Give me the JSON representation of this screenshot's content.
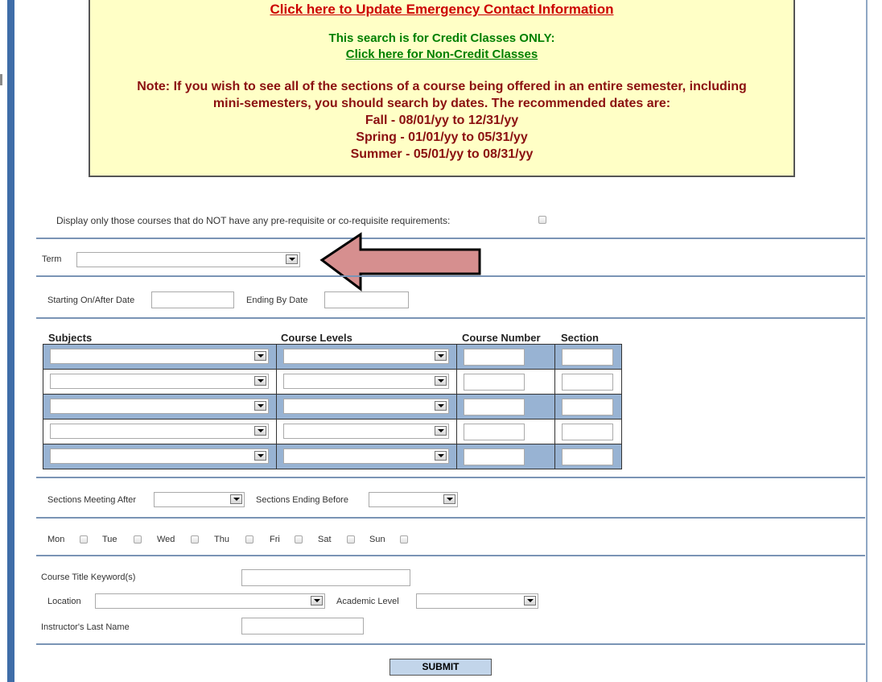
{
  "notice": {
    "emergency_link": "Click here to Update Emergency Contact Information",
    "credit_only": "This search is for Credit Classes ONLY:",
    "noncredit_link": "Click here for Non-Credit Classes",
    "note_line1": "Note: If you wish to see all of the sections of a course being offered in an entire semester, including",
    "note_line2": "mini-semesters, you should search by dates. The recommended dates are:",
    "fall": "Fall - 08/01/yy to 12/31/yy",
    "spring": "Spring - 01/01/yy to 05/31/yy",
    "summer": "Summer - 05/01/yy to 08/31/yy"
  },
  "prereq_label": "Display only those courses that do NOT have any pre-requisite or co-requisite requirements:",
  "term": {
    "label": "Term",
    "value": ""
  },
  "dates": {
    "start_label": "Starting On/After Date",
    "end_label": "Ending By Date",
    "start_value": "",
    "end_value": ""
  },
  "table": {
    "headers": {
      "subjects": "Subjects",
      "levels": "Course Levels",
      "number": "Course Number",
      "section": "Section"
    },
    "row_count": 5
  },
  "times": {
    "after_label": "Sections Meeting After",
    "before_label": "Sections Ending Before"
  },
  "days": [
    "Mon",
    "Tue",
    "Wed",
    "Thu",
    "Fri",
    "Sat",
    "Sun"
  ],
  "keyword_label": "Course Title Keyword(s)",
  "location_label": "Location",
  "academic_level_label": "Academic Level",
  "instructor_label": "Instructor's Last Name",
  "submit_label": "SUBMIT",
  "colors": {
    "arrow_fill": "#d68f8f",
    "row_shade": "#98b3d3",
    "notice_bg": "#ffffc6"
  }
}
